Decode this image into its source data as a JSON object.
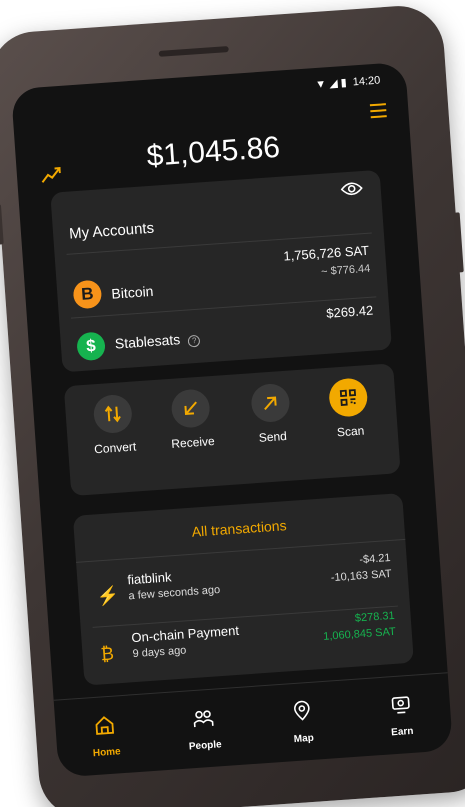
{
  "status_bar": {
    "time": "14:20"
  },
  "header": {
    "balance": "$1,045.86"
  },
  "accounts": {
    "title": "My Accounts",
    "bitcoin": {
      "name": "Bitcoin",
      "sats": "1,756,726 SAT",
      "usd_approx": "~ $776.44"
    },
    "stablesats": {
      "name": "Stablesats",
      "usd": "$269.42"
    }
  },
  "actions": [
    {
      "label": "Convert"
    },
    {
      "label": "Receive"
    },
    {
      "label": "Send"
    },
    {
      "label": "Scan"
    }
  ],
  "transactions": {
    "title": "All transactions",
    "items": [
      {
        "name": "fiatblink",
        "time": "a few seconds ago",
        "fiat": "-$4.21",
        "sats": "-10,163 SAT"
      },
      {
        "name": "On-chain Payment",
        "time": "9 days ago",
        "fiat": "$278.31",
        "sats": "1,060,845 SAT"
      }
    ]
  },
  "nav": [
    {
      "label": "Home"
    },
    {
      "label": "People"
    },
    {
      "label": "Map"
    },
    {
      "label": "Earn"
    }
  ],
  "colors": {
    "accent": "#f2a900",
    "positive": "#16b34f",
    "bitcoin": "#f7931a"
  }
}
